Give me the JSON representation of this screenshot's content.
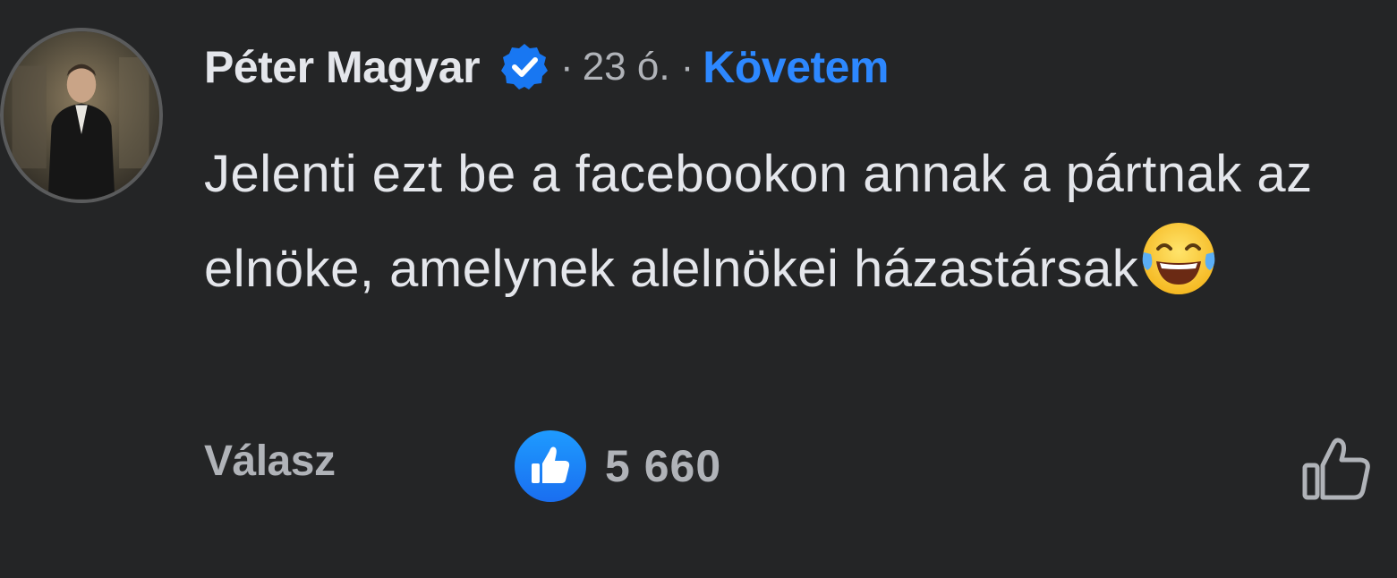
{
  "comment": {
    "author": "Péter Magyar",
    "separator_1": "·",
    "time": "23 ó.",
    "separator_2": "·",
    "follow_label": "Követem",
    "text": "Jelenti ezt be a facebookon annak a pártnak az elnöke, amelynek alelnökei házastársak",
    "emoji": "face-with-tears-of-joy-emoji"
  },
  "actions": {
    "reply_label": "Válasz",
    "reaction_count": "5 660",
    "reaction_icon": "like-reaction-icon",
    "like_button_icon": "thumbs-up-outline-icon"
  },
  "colors": {
    "background": "#242526",
    "primary_text": "#e4e6eb",
    "secondary_text": "#b0b3b8",
    "accent_blue": "#2d88ff",
    "verified_blue": "#1877f2"
  }
}
